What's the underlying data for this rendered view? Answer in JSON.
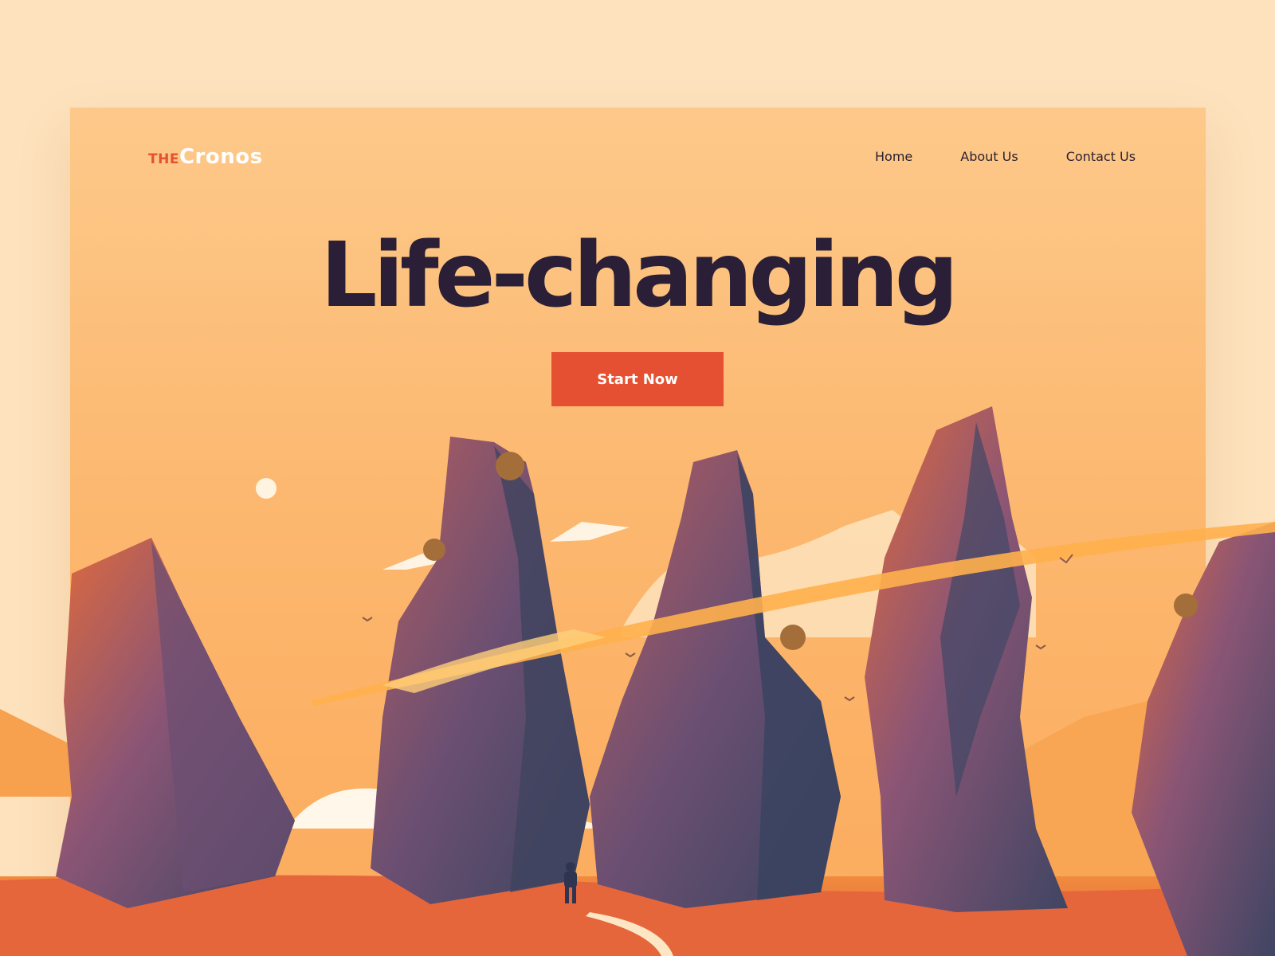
{
  "header": {
    "logo_prefix": "THE",
    "logo_name": "Cronos",
    "nav": [
      {
        "label": "Home"
      },
      {
        "label": "About Us"
      },
      {
        "label": "Contact Us"
      }
    ]
  },
  "hero": {
    "title": "Life-changing",
    "cta_label": "Start Now"
  },
  "colors": {
    "page_bg": "#fde2bd",
    "card_bg": "#fcb870",
    "accent": "#e55032",
    "title": "#2a1f36",
    "rock_dark": "#3f4563",
    "rock_mid": "#7c5073",
    "rock_warm": "#d4673d"
  },
  "icons": {
    "illustration": "desert-rock-pillars-illustration",
    "sun": "sun-icon"
  }
}
